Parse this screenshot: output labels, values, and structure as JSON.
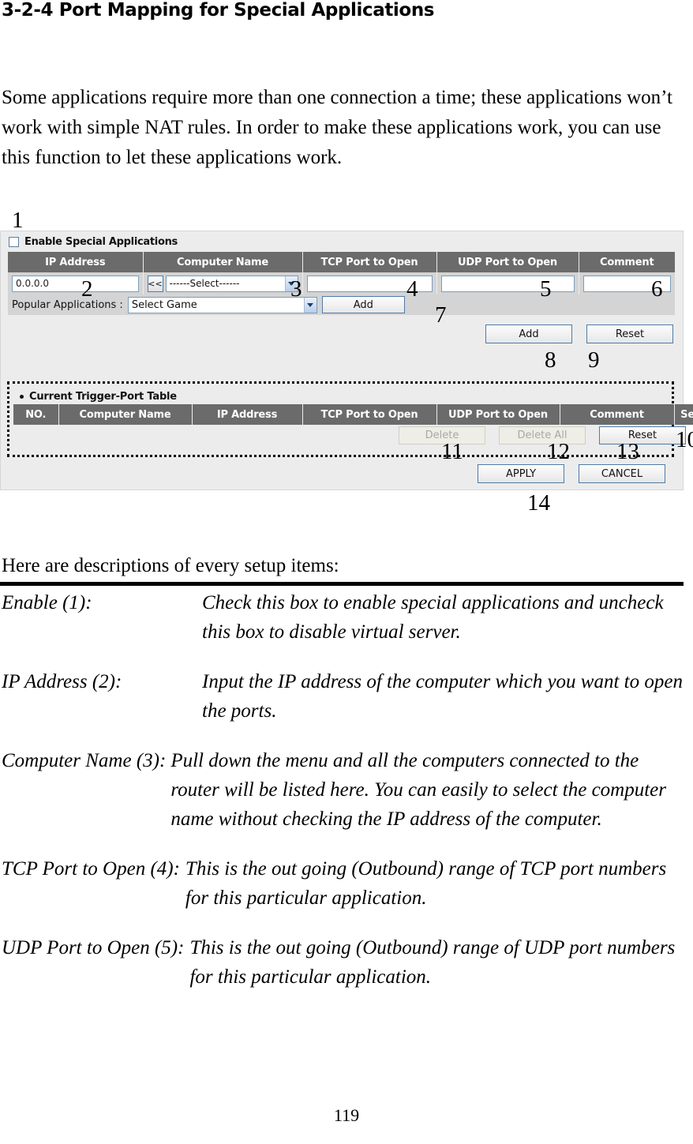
{
  "document": {
    "title": "3-2-4 Port Mapping for Special Applications",
    "intro": "Some applications require more than one connection a time; these applications won’t work with simple NAT rules. In order to make these applications work, you can use this function to let these applications work.",
    "descriptions_lead": "Here are descriptions of every setup items:",
    "page_number": "119"
  },
  "screenshot": {
    "enable_checkbox_label": "Enable Special Applications",
    "main_table": {
      "headers": [
        "IP Address",
        "Computer Name",
        "TCP Port to Open",
        "UDP Port to Open",
        "Comment"
      ],
      "ip_address_value": "0.0.0.0",
      "computer_name_button": "<<",
      "computer_name_selected": "------Select------",
      "tcp_port_value": "",
      "udp_port_value": "",
      "comment_value": ""
    },
    "popular": {
      "label": "Popular Applications  :",
      "selected": "Select Game",
      "add_label": "Add"
    },
    "entry_buttons": {
      "add": "Add",
      "reset": "Reset"
    },
    "trigger_table": {
      "title": "Current Trigger-Port Table",
      "headers": [
        "NO.",
        "Computer Name",
        "IP Address",
        "TCP Port to Open",
        "UDP Port to Open",
        "Comment",
        "Select"
      ],
      "rows": []
    },
    "table_buttons": {
      "delete": "Delete",
      "delete_all": "Delete All",
      "reset": "Reset"
    },
    "form_buttons": {
      "apply": "APPLY",
      "cancel": "CANCEL"
    },
    "callouts": {
      "c1": "1",
      "c2": "2",
      "c3": "3",
      "c4": "4",
      "c5": "5",
      "c6": "6",
      "c7": "7",
      "c8": "8",
      "c9": "9",
      "c10": "10",
      "c11": "11",
      "c12": "12",
      "c13": "13",
      "c14": "14"
    },
    "colors": {
      "panel_bg": "#ececec",
      "header_gray": "#6b6b6b",
      "row_gray": "#d4d4d4",
      "field_border": "#7b9dbb"
    }
  },
  "definitions": [
    {
      "term": "Enable (1):",
      "desc": "Check this box to enable special applications and uncheck this box to disable virtual server."
    },
    {
      "term": "IP Address (2):",
      "desc": "Input the IP address of the computer which you want to open the ports."
    },
    {
      "term": "Computer Name (3):",
      "desc": "Pull down the menu and all the computers connected to the router will be listed here. You can easily to select the computer name without checking the IP address of the computer."
    },
    {
      "term": "TCP Port to Open (4):",
      "desc": "This is the out going (Outbound) range of TCP port numbers for this particular application."
    },
    {
      "term": "UDP Port to Open (5):",
      "desc": "This is the out going (Outbound) range of UDP port numbers for this particular application."
    }
  ]
}
